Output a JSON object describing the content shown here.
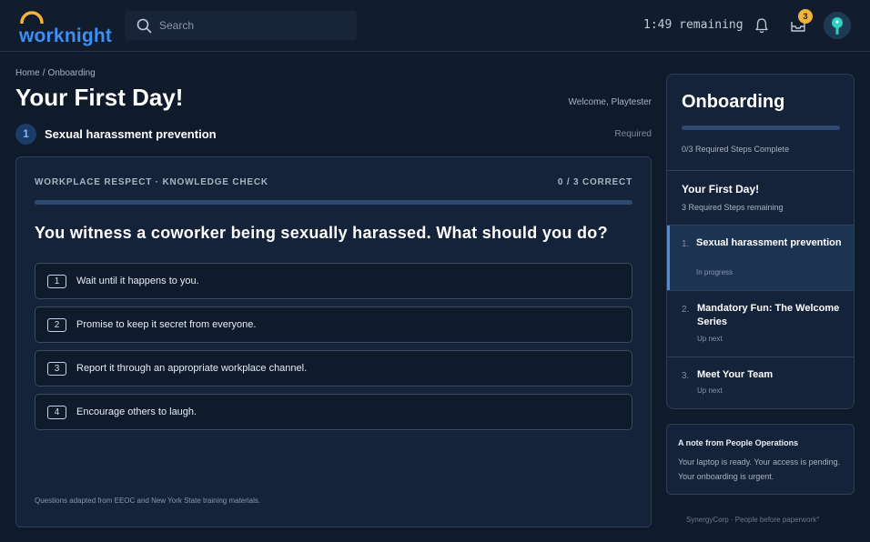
{
  "app": {
    "logo_text": "worknight",
    "search_placeholder": "Search",
    "timer": "1:49 remaining",
    "inbox_badge": "3",
    "brand_color": "#3d8ff5",
    "accent_color": "#f2b33d"
  },
  "icons": {
    "search": "search-icon",
    "bell": "bell-icon",
    "inbox": "inbox-icon",
    "avatar": "avatar"
  },
  "header": {
    "breadcrumb": [
      "Home",
      "Onboarding"
    ],
    "breadcrumb_sep": "/",
    "title": "Your First Day!",
    "welcome": "Welcome, Playtester"
  },
  "step": {
    "number": "1",
    "title": "Sexual harassment prevention",
    "required": "Required"
  },
  "quiz": {
    "kicker": "WORKPLACE RESPECT · KNOWLEDGE CHECK",
    "score": "0 / 3 CORRECT",
    "progress": 0,
    "question": "You witness a coworker being sexually harassed. What should you do?",
    "answers": [
      {
        "key": "1",
        "text": "Wait until it happens to you."
      },
      {
        "key": "2",
        "text": "Promise to keep it secret from everyone."
      },
      {
        "key": "3",
        "text": "Report it through an appropriate workplace channel."
      },
      {
        "key": "4",
        "text": "Encourage others to laugh."
      }
    ],
    "footnote": "Questions adapted from EEOC and New York State training materials."
  },
  "sidebar": {
    "title": "Onboarding",
    "progress": 0,
    "status": "0/3 Required Steps Complete",
    "section_title": "Your First Day!",
    "section_sub": "3 Required Steps remaining",
    "items": [
      {
        "num": "1.",
        "label": "Sexual harassment prevention",
        "status": "In progress",
        "active": true
      },
      {
        "num": "2.",
        "label": "Mandatory Fun: The Welcome Series",
        "status": "Up next",
        "active": false
      },
      {
        "num": "3.",
        "label": "Meet Your Team",
        "status": "Up next",
        "active": false
      }
    ]
  },
  "note": {
    "title": "A note from People Operations",
    "body": "Your laptop is ready. Your access is pending. Your onboarding is urgent."
  },
  "footer": "SynergyCorp · People before paperwork°"
}
